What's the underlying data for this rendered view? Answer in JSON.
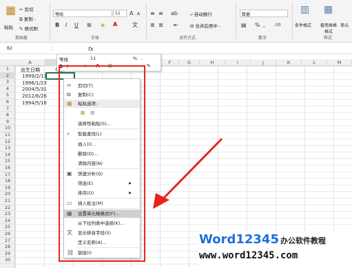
{
  "ribbon": {
    "clipboard": {
      "cut": "剪切",
      "copy": "复制 -",
      "painter": "格式刷",
      "paste": "粘贴",
      "label": "剪贴板"
    },
    "font": {
      "name": "等线",
      "size": "11",
      "bold": "B",
      "italic": "I",
      "underline": "U",
      "label": "字体",
      "grow": "A",
      "shrink": "A",
      "wen": "文"
    },
    "align": {
      "wrap": "自动换行",
      "merge": "合并后居中 -",
      "label": "对齐方式"
    },
    "number": {
      "format": "数据",
      "currency": "%",
      "comma": ",",
      "label": "数字"
    },
    "styles": {
      "cond": "条件格式",
      "table": "套用表格格式",
      "cell": "单元",
      "label": "样式"
    }
  },
  "formula_bar": {
    "name_box": "B2",
    "fx": "fx"
  },
  "columns": [
    "A",
    "B",
    "C",
    "D",
    "E",
    "F",
    "G",
    "H",
    "I",
    "J",
    "K",
    "L",
    "M"
  ],
  "rows": [
    "1",
    "2",
    "3",
    "4",
    "5",
    "6",
    "7",
    "8",
    "9",
    "10",
    "11",
    "12",
    "13",
    "14",
    "15",
    "16",
    "17",
    "18",
    "19",
    "20",
    "21",
    "22",
    "23",
    "24",
    "25",
    "26",
    "27",
    "28",
    "29",
    "30"
  ],
  "cells": {
    "a1": "出生日期",
    "b1": "年龄",
    "a2": "1999/2/13",
    "a3": "1996/1/23",
    "a4": "2004/5/31",
    "a5": "2012/6/26",
    "a6": "1994/5/16"
  },
  "minibar": {
    "font": "等线",
    "size": "11",
    "percent": "%",
    "comma": ","
  },
  "context_menu": {
    "items": [
      "剪切(T)",
      "复制(C)",
      "粘贴选项:",
      "",
      "选择性粘贴(S)...",
      "智能查找(L)",
      "插入(I)...",
      "删除(D)...",
      "清除内容(N)",
      "快速分析(Q)",
      "筛选(E)",
      "排序(O)",
      "插入批注(M)",
      "设置单元格格式(F)...",
      "从下拉列表中选择(K)...",
      "显示拼音字段(S)",
      "定义名称(A)...",
      "链接(I)"
    ],
    "highlighted": "设置单元格格式(F)..."
  },
  "watermark": {
    "brand": "Word12345",
    "cn": "办公软件教程",
    "url": "www.word12345.com"
  },
  "colors": {
    "accent": "#e8231b",
    "brand_blue": "#1f6fd6"
  }
}
